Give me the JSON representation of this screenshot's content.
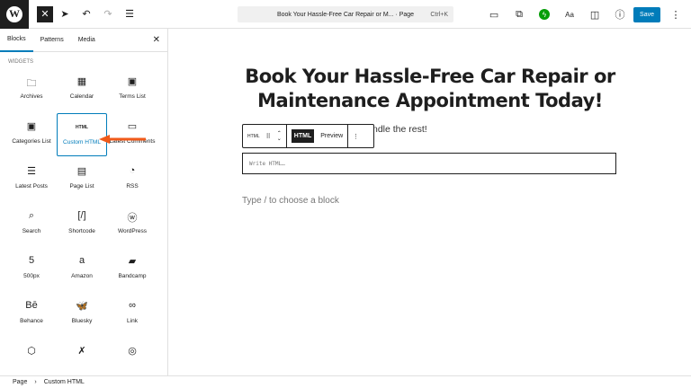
{
  "topbar": {
    "logo": "W",
    "doc_title": "Book Your Hassle-Free Car Repair or M... · Page",
    "shortcut": "Ctrl+K",
    "save": "Save",
    "styles": "Aa",
    "jetpack": "ϟ"
  },
  "sidebar": {
    "tabs": [
      "Blocks",
      "Patterns",
      "Media"
    ],
    "category": "Widgets",
    "blocks": [
      {
        "label": "Archives",
        "icon": "🗀"
      },
      {
        "label": "Calendar",
        "icon": "▦"
      },
      {
        "label": "Terms List",
        "icon": "▣"
      },
      {
        "label": "Categories List",
        "icon": "▣"
      },
      {
        "label": "Custom HTML",
        "icon": "HTML",
        "selected": true
      },
      {
        "label": "Latest Comments",
        "icon": "▭"
      },
      {
        "label": "Latest Posts",
        "icon": "☰"
      },
      {
        "label": "Page List",
        "icon": "▤"
      },
      {
        "label": "RSS",
        "icon": "◔"
      },
      {
        "label": "Search",
        "icon": "⌕"
      },
      {
        "label": "Shortcode",
        "icon": "[/]"
      },
      {
        "label": "WordPress",
        "icon": "ⓦ"
      },
      {
        "label": "500px",
        "icon": "5"
      },
      {
        "label": "Amazon",
        "icon": "a"
      },
      {
        "label": "Bandcamp",
        "icon": "▰"
      },
      {
        "label": "Behance",
        "icon": "Bē"
      },
      {
        "label": "Bluesky",
        "icon": "🦋"
      },
      {
        "label": "Link",
        "icon": "∞"
      },
      {
        "label": "",
        "icon": "⬡"
      },
      {
        "label": "",
        "icon": "✗"
      },
      {
        "label": "",
        "icon": "◎"
      }
    ]
  },
  "main": {
    "heading": "Book Your Hassle-Free Car Repair or Maintenance Appointment Today!",
    "paragraph_tail": "ndle the rest!",
    "toolbar": {
      "block": "HTML",
      "html": "HTML",
      "preview": "Preview"
    },
    "html_placeholder": "Write HTML…",
    "appender": "Type / to choose a block"
  },
  "breadcrumb": [
    "Page",
    "Custom HTML"
  ],
  "colors": {
    "accent": "#007cba",
    "arrow": "#f05a1a"
  }
}
